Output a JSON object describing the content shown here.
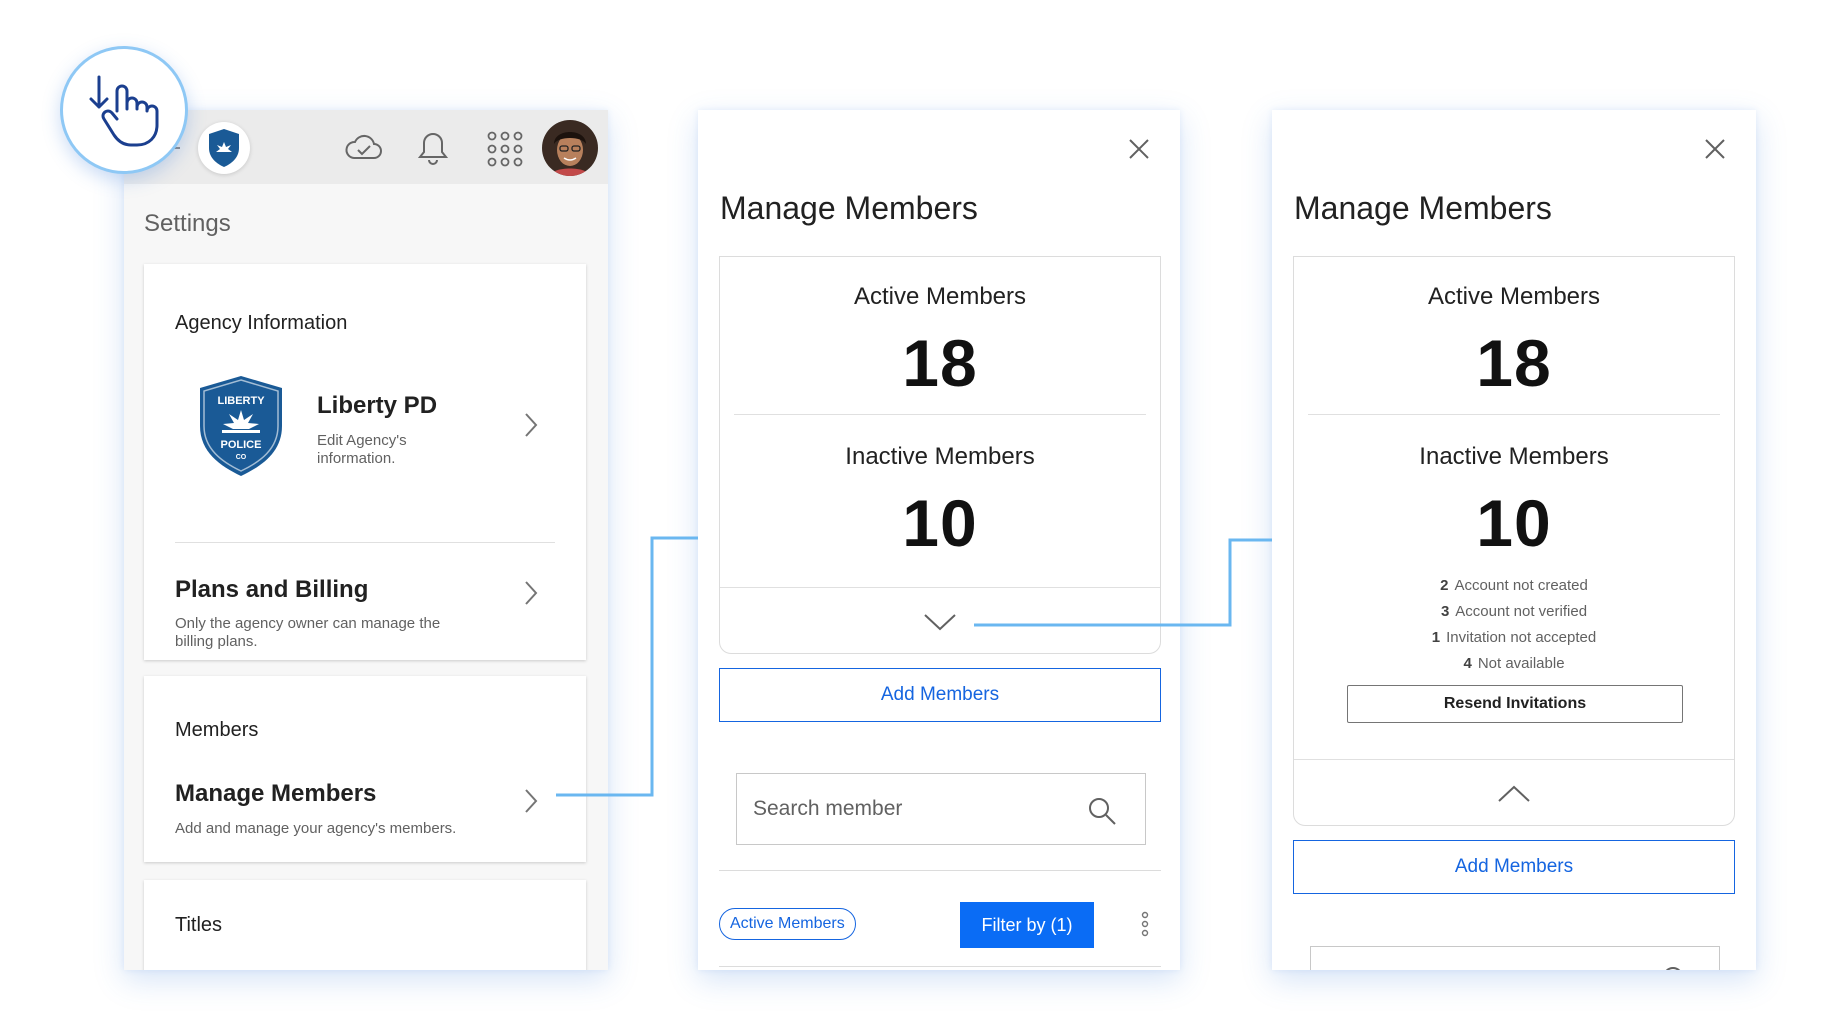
{
  "settings_screen": {
    "title": "Settings",
    "agency_card": {
      "heading": "Agency Information",
      "agency_name": "Liberty PD",
      "agency_sub": "Edit Agency's information.",
      "logo_text_top": "LIBERTY",
      "logo_text_bottom": "POLICE",
      "logo_text_co": "CO",
      "plans_title": "Plans and Billing",
      "plans_sub": "Only the agency owner can manage the billing plans."
    },
    "members_card": {
      "heading": "Members",
      "manage_title": "Manage Members",
      "manage_sub": "Add and manage your agency's members."
    },
    "titles_card": {
      "heading": "Titles"
    },
    "topbar_icons": [
      "menu-icon",
      "agency-logo",
      "cloud-sync-icon",
      "bell-icon",
      "apps-grid-icon",
      "avatar"
    ]
  },
  "manage_members_collapsed": {
    "title": "Manage Members",
    "active_label": "Active Members",
    "active_count": "18",
    "inactive_label": "Inactive Members",
    "inactive_count": "10",
    "add_button": "Add Members",
    "search_placeholder": "Search member",
    "chip_label": "Active Members",
    "filter_button": "Filter by (1)"
  },
  "manage_members_expanded": {
    "title": "Manage Members",
    "active_label": "Active Members",
    "active_count": "18",
    "inactive_label": "Inactive Members",
    "inactive_count": "10",
    "breakdown": [
      {
        "count": "2",
        "label": "Account not created"
      },
      {
        "count": "3",
        "label": "Account not verified"
      },
      {
        "count": "1",
        "label": "Invitation not accepted"
      },
      {
        "count": "4",
        "label": "Not available"
      }
    ],
    "resend_button": "Resend Invitations",
    "add_button": "Add Members"
  },
  "colors": {
    "accent_blue": "#1565e0",
    "primary_button": "#0a6cf5",
    "badge_blue": "#1a5a96",
    "connector": "#6ab7f0"
  }
}
